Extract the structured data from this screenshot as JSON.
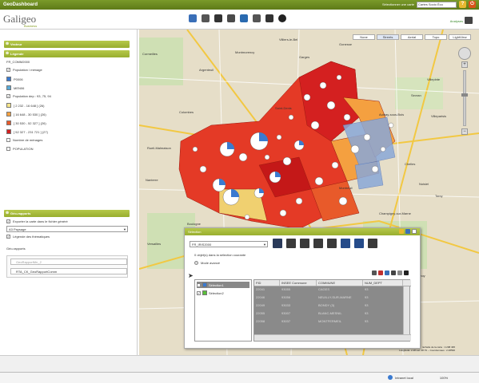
{
  "window": {
    "title": "GeoDashboard",
    "selector_label": "Sélectionner une carte",
    "selector_value": "Cartes Socio Éco"
  },
  "header": {
    "logo": "Galigeo",
    "logo_tag": "Business",
    "user_link": "Analyses"
  },
  "sidebar": {
    "panel_vecteur": "Vecteur",
    "panel_legende": "Légende",
    "layer_name": "FR_COMM2000",
    "legend_items": [
      {
        "label": "Population / ménage",
        "color": "",
        "kind": "checkbox"
      },
      {
        "label": "P0006",
        "color": "#3a7ad0",
        "kind": "swatch"
      },
      {
        "label": "MEN06",
        "color": "#5aaad8",
        "kind": "swatch"
      },
      {
        "label": "Population dep : 93, 75, 94",
        "color": "",
        "kind": "checkbox"
      },
      {
        "label": "[ 2 232 - 16 648 ]  (26)",
        "color": "#f6e58a",
        "kind": "swatch"
      },
      {
        "label": "] 16 648 - 30 530 ]  (26)",
        "color": "#f4a040",
        "kind": "swatch"
      },
      {
        "label": "] 30 530 - 52 327 ]  (26)",
        "color": "#e85a2a",
        "kind": "swatch"
      },
      {
        "label": "] 52 327 - 231 721 ]  (27)",
        "color": "#d42020",
        "kind": "swatch"
      },
      {
        "label": "Nombre de ménages",
        "color": "",
        "kind": "checkbox"
      },
      {
        "label": "POPULATION",
        "color": "",
        "kind": "checkbox"
      }
    ],
    "panel_rapports": "Géo-rapports",
    "export_label": "Exporter la carte dans le fichier généré",
    "format_value": "A3 Paysage",
    "legend_thematic_label": "Légende des thématiques",
    "rapports_title": "Géo-rapports",
    "rapports": [
      "GeoRapportMn_2",
      "RTA_CK_GeoRapportComm"
    ]
  },
  "map": {
    "tabs": [
      "None",
      "Streets",
      "Aerial",
      "Topo",
      "LightView"
    ],
    "active_tab": "Streets",
    "scale_text": "Echelle de la carte : 1:298 495",
    "coords_text": "Longitude: 2.48 Lat: 48.79 -- Coordonnées : 2.48596",
    "place_labels": [
      "Cormeilles",
      "Argenteuil",
      "Colombes",
      "Nanterre",
      "Boulogne",
      "Saint-Denis",
      "Aulnay-sous-Bois",
      "Sevran",
      "Villepinte",
      "Chelles",
      "Villiers-le-Bel",
      "Montmorency",
      "Garges",
      "Montreuil",
      "Champigny-sur-Marne",
      "Sucy-en-Brie",
      "Créteil",
      "Versailles",
      "Vélizy",
      "Massy",
      "Gonesse",
      "Villeparisis",
      "Noisiel",
      "Torcy",
      "Brunoy",
      "Evry",
      "Rueil-Malmaison",
      "Bagneux",
      "Choisy-le-Roi"
    ]
  },
  "selection": {
    "title": "Sélection",
    "layer": "FR_IRIS2000",
    "info": "0 objet(s) dans la sélection courante",
    "mode": "Mode avancé",
    "list": [
      {
        "name": "Sélection1",
        "color": "#3a7ad0",
        "highlight": true
      },
      {
        "name": "Sélection2",
        "color": "#5ac03a",
        "highlight": false
      }
    ],
    "columns": [
      "FID",
      "INSEE Commune",
      "COMMUNE",
      "NUM_DEPT"
    ],
    "rows": [
      [
        "22041",
        "93055",
        "CAGES",
        "93"
      ],
      [
        "22046",
        "93056",
        "NEUILLY-SUR-MARNE",
        "93"
      ],
      [
        "22049",
        "93033",
        "BONDY (3)",
        "93"
      ],
      [
        "22055",
        "93007",
        "BLANC-MESNIL",
        "93"
      ],
      [
        "22058",
        "93037",
        "MONTFERMEIL",
        "93"
      ]
    ]
  },
  "status": {
    "zone": "Intranet local",
    "zoom": "100%"
  }
}
